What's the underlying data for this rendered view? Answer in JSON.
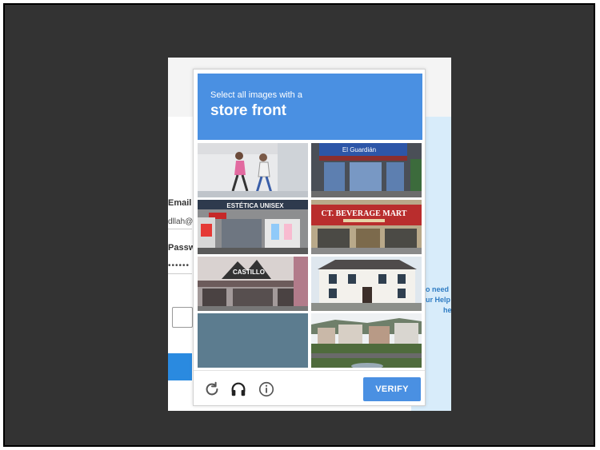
{
  "background_page": {
    "email_label": "Email a",
    "email_value": "dllah@",
    "password_label": "Passw",
    "password_value": "••••••",
    "help_text": [
      "o need",
      "ur Help",
      "he"
    ],
    "accent_color": "#2a8ae0"
  },
  "captcha": {
    "instruction_line1": "Select all images with a",
    "instruction_target": "store front",
    "header_color": "#4a90e2",
    "tiles": [
      {
        "label": "",
        "icon": "runners-tile"
      },
      {
        "label": "El Guardián",
        "icon": "storefront-tile"
      },
      {
        "label": "ESTÉTICA UNISEX",
        "icon": "storefront-tile"
      },
      {
        "label": "CT. BEVERAGE MART",
        "icon": "storefront-tile"
      },
      {
        "label": "CASTILLO",
        "icon": "storefront-tile"
      },
      {
        "label": "",
        "icon": "house-tile"
      },
      {
        "label": "",
        "icon": "blank-tile"
      },
      {
        "label": "",
        "icon": "town-tile"
      }
    ],
    "footer": {
      "reload_icon": "reload-icon",
      "audio_icon": "headphones-icon",
      "info_icon": "info-icon",
      "verify_label": "VERIFY"
    }
  }
}
